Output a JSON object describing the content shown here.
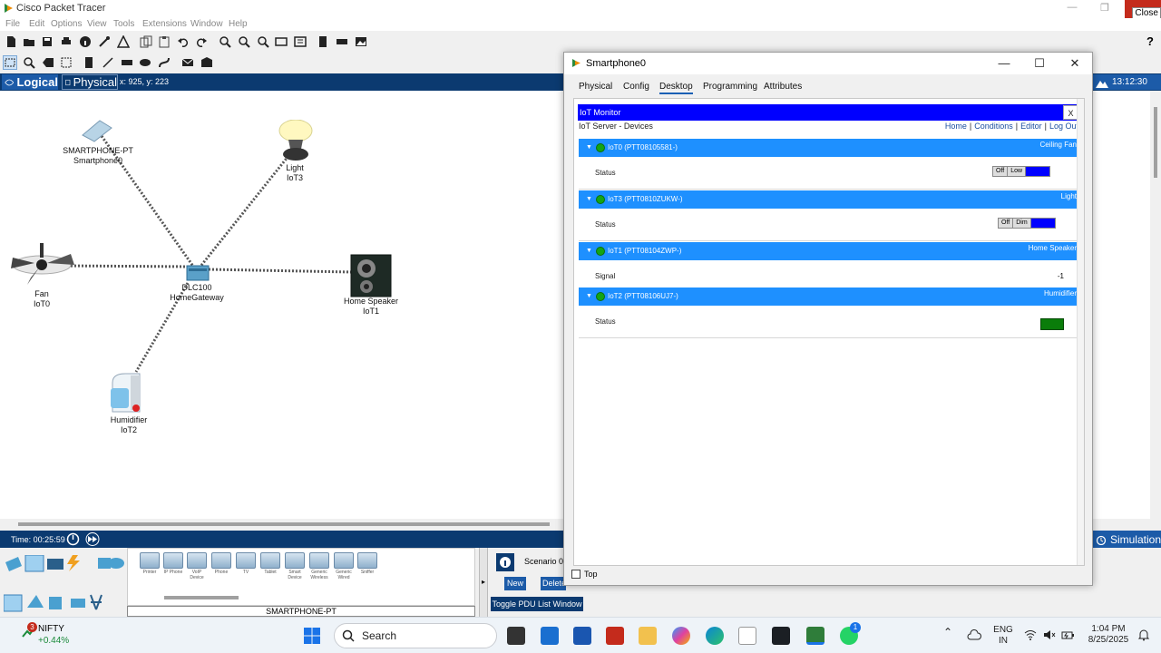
{
  "app": {
    "title": "Cisco Packet Tracer",
    "close_tooltip": "Close"
  },
  "menu": [
    "File",
    "Edit",
    "Options",
    "View",
    "Tools",
    "Extensions",
    "Window",
    "Help"
  ],
  "toolbar": {
    "help_label": "?"
  },
  "view_tabs": {
    "logical": "Logical",
    "physical": "Physical",
    "coords": "x: 925, y: 223",
    "clock": "13:12:30"
  },
  "topology": {
    "devices": [
      {
        "id": "smartphone",
        "label1": "SMARTPHONE-PT",
        "label2": "Smartphone0"
      },
      {
        "id": "light",
        "label1": "Light",
        "label2": "IoT3"
      },
      {
        "id": "fan",
        "label1": "Fan",
        "label2": "IoT0"
      },
      {
        "id": "gateway",
        "label1": "DLC100",
        "label2": "HomeGateway"
      },
      {
        "id": "speaker",
        "label1": "Home Speaker",
        "label2": "IoT1"
      },
      {
        "id": "humidifier",
        "label1": "Humidifier",
        "label2": "IoT2"
      }
    ]
  },
  "status": {
    "time_label": "Time: 00:25:59",
    "simulation": "Simulation"
  },
  "device_panel": {
    "selected_name": "SMARTPHONE-PT",
    "items": [
      "Printer",
      "IP Phone",
      "VoIP Device",
      "Phone",
      "TV",
      "Tablet",
      "Smart Device",
      "Generic Wireless",
      "Generic Wired",
      "Sniffer"
    ]
  },
  "pdu": {
    "scenario": "Scenario 0",
    "new": "New",
    "delete": "Delete",
    "toggle": "Toggle PDU List Window"
  },
  "smartphone_window": {
    "title": "Smartphone0",
    "tabs": [
      "Physical",
      "Config",
      "Desktop",
      "Programming",
      "Attributes"
    ],
    "active_tab": "Desktop",
    "top_checkbox": "Top",
    "iot_monitor": {
      "title": "IoT Monitor",
      "close": "X",
      "subtitle": "IoT Server - Devices",
      "nav": [
        "Home",
        "Conditions",
        "Editor",
        "Log Out"
      ],
      "devices": [
        {
          "name": "IoT0 (PTT08105581-)",
          "type": "Ceiling Fan",
          "prop": "Status",
          "buttons": [
            "Off",
            "Low"
          ]
        },
        {
          "name": "IoT3 (PTT0810ZUKW-)",
          "type": "Light",
          "prop": "Status",
          "buttons": [
            "Off",
            "Dim"
          ]
        },
        {
          "name": "IoT1 (PTT08104ZWP-)",
          "type": "Home Speaker",
          "prop": "Signal",
          "value": "-1"
        },
        {
          "name": "IoT2 (PTT08106UJ7-)",
          "type": "Humidifier",
          "prop": "Status"
        }
      ]
    }
  },
  "taskbar": {
    "stock_name": "NIFTY",
    "stock_change": "+0.44%",
    "stock_badge": "3",
    "search_label": "Search",
    "lang_line1": "ENG",
    "lang_line2": "IN",
    "time": "1:04 PM",
    "date": "8/25/2025",
    "whatsapp_badge": "1"
  }
}
